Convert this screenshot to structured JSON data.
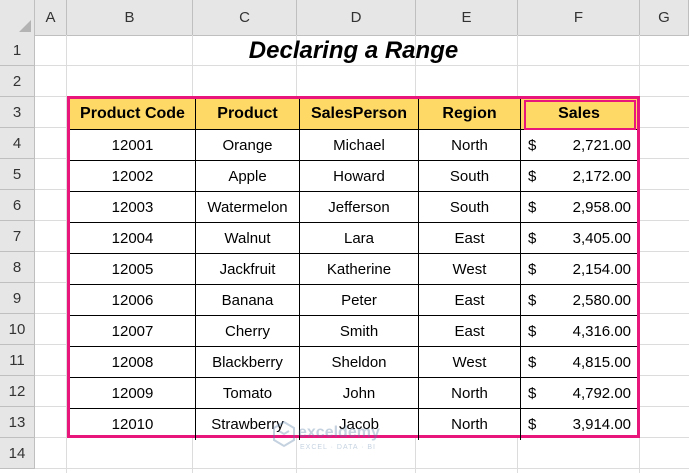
{
  "columns": [
    "A",
    "B",
    "C",
    "D",
    "E",
    "F",
    "G"
  ],
  "rows": [
    "1",
    "2",
    "3",
    "4",
    "5",
    "6",
    "7",
    "8",
    "9",
    "10",
    "11",
    "12",
    "13",
    "14"
  ],
  "title": "Declaring a Range",
  "table": {
    "headers": [
      "Product Code",
      "Product",
      "SalesPerson",
      "Region",
      "Sales"
    ],
    "currency_symbol": "$",
    "rows": [
      [
        "12001",
        "Orange",
        "Michael",
        "North",
        "2,721.00"
      ],
      [
        "12002",
        "Apple",
        "Howard",
        "South",
        "2,172.00"
      ],
      [
        "12003",
        "Watermelon",
        "Jefferson",
        "South",
        "2,958.00"
      ],
      [
        "12004",
        "Walnut",
        "Lara",
        "East",
        "3,405.00"
      ],
      [
        "12005",
        "Jackfruit",
        "Katherine",
        "West",
        "2,154.00"
      ],
      [
        "12006",
        "Banana",
        "Peter",
        "East",
        "2,580.00"
      ],
      [
        "12007",
        "Cherry",
        "Smith",
        "East",
        "4,316.00"
      ],
      [
        "12008",
        "Blackberry",
        "Sheldon",
        "West",
        "4,815.00"
      ],
      [
        "12009",
        "Tomato",
        "John",
        "North",
        "4,792.00"
      ],
      [
        "12010",
        "Strawberry",
        "Jacob",
        "North",
        "3,914.00"
      ]
    ]
  },
  "watermark": {
    "name": "exceldemy",
    "tagline": "EXCEL · DATA · BI"
  },
  "colors": {
    "header_fill": "#ffd966",
    "border_accent": "#e8157a"
  }
}
